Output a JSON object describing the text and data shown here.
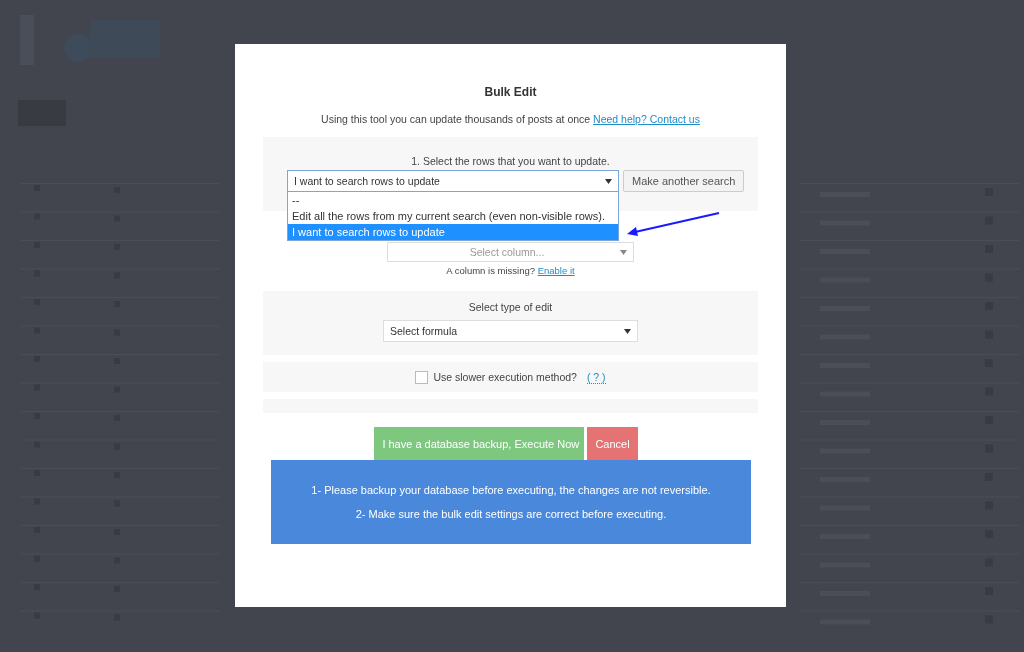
{
  "modal": {
    "title": "Bulk Edit",
    "intro": "Using this tool you can update thousands of posts at once",
    "help_link": "Need help? Contact us"
  },
  "rows_section": {
    "label": "1. Select the rows that you want to update.",
    "select_value": "I want to search rows to update",
    "button": "Make another search",
    "dropdown": {
      "expanded": true,
      "options": [
        {
          "label": "--",
          "selected": false
        },
        {
          "label": "Edit all the rows from my current search (even non-visible rows).",
          "selected": false
        },
        {
          "label": "I want to search rows to update",
          "selected": true
        }
      ]
    }
  },
  "column_section": {
    "placeholder": "Select column...",
    "missing_note": "A column is missing?",
    "link": "Enable it"
  },
  "edit_section": {
    "label": "Select type of edit",
    "select_value": "Select formula"
  },
  "slow_option": {
    "label": "Use slower execution method?",
    "checked": false,
    "help": "( ? )"
  },
  "buttons": [
    {
      "label": "I have a database backup, Execute Now",
      "kind": "execute"
    },
    {
      "label": "Cancel",
      "kind": "cancel"
    }
  ],
  "notice": [
    "1- Please backup your database before executing, the changes are not reversible.",
    "2- Make sure the bulk edit settings are correct before executing."
  ]
}
